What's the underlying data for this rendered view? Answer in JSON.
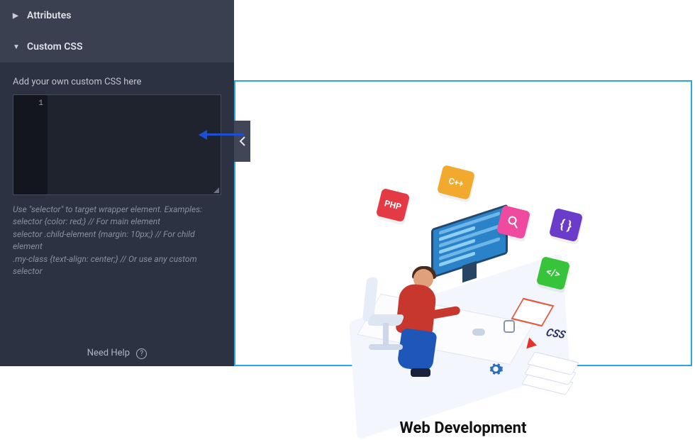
{
  "sidebar": {
    "panels": {
      "attributes": {
        "label": "Attributes"
      },
      "custom_css": {
        "label": "Custom CSS"
      }
    },
    "css_section": {
      "label": "Add your own custom CSS here",
      "line_number": "1",
      "value": "",
      "help_text": "Use \"selector\" to target wrapper element. Examples:\nselector {color: red;} // For main element\nselector .child-element {margin: 10px;} // For child element\n.my-class {text-align: center;} // Or use any custom selector"
    },
    "footer": {
      "need_help": "Need Help"
    }
  },
  "canvas": {
    "title": "Web Development",
    "badges": {
      "php": "PHP",
      "cpp": "C++",
      "braces": "{ }",
      "tag": "</>"
    },
    "stack_label": "CSS"
  },
  "colors": {
    "panel_bg": "#2c3241",
    "selection_border": "#2aa7e0",
    "arrow": "#1a4fd6"
  }
}
